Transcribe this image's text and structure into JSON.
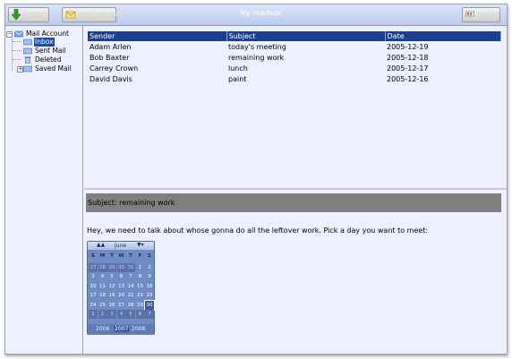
{
  "window": {
    "title": "My mailbox"
  },
  "toolbar": {
    "get_mail_label": "Get Mail",
    "new_message_label": "New Message",
    "options_label": "Options"
  },
  "tree": {
    "root": "Mail Account",
    "items": [
      {
        "label": "Inbox",
        "selected": true
      },
      {
        "label": "Sent Mail",
        "selected": false
      },
      {
        "label": "Deleted",
        "selected": false
      },
      {
        "label": "Saved Mail",
        "selected": false
      }
    ]
  },
  "message_list": {
    "columns": [
      "Sender",
      "Subject",
      "Date"
    ],
    "rows": [
      [
        "Adam Arlen",
        "today's meeting",
        "2005-12-19"
      ],
      [
        "Bob Baxter",
        "remaining work",
        "2005-12-18"
      ],
      [
        "Carrey Crown",
        "lunch",
        "2005-12-17"
      ],
      [
        "David Davis",
        "paint",
        "2005-12-16"
      ]
    ]
  },
  "preview": {
    "subject": "Subject: remaining work",
    "body": "Hey, we need to talk about whose gonna do all the leftover work. Pick a day you want to meet:"
  },
  "calendar": {
    "month": "June",
    "prev_glyph": "▲▲",
    "next_glyph": "▼▾",
    "weekdays": [
      "S",
      "M",
      "T",
      "W",
      "T",
      "F",
      "S"
    ],
    "weeks": [
      [
        "27",
        "28",
        "29",
        "30",
        "31",
        "1",
        "2"
      ],
      [
        "3",
        "4",
        "5",
        "6",
        "7",
        "8",
        "9"
      ],
      [
        "10",
        "11",
        "12",
        "13",
        "14",
        "15",
        "16"
      ],
      [
        "17",
        "18",
        "19",
        "20",
        "21",
        "22",
        "23"
      ],
      [
        "24",
        "25",
        "26",
        "27",
        "28",
        "29",
        "30"
      ],
      [
        "1",
        "2",
        "3",
        "4",
        "5",
        "6",
        "7"
      ]
    ],
    "selected_day": "30",
    "years": [
      "2006",
      "2007",
      "2008"
    ],
    "current_year": "2007"
  }
}
